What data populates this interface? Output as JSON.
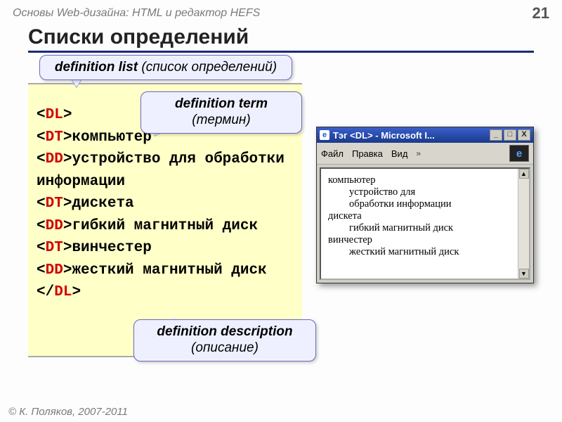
{
  "header": {
    "breadcrumb": "Основы Web-дизайна: HTML и редактор HEFS",
    "page_number": "21"
  },
  "title": "Списки определений",
  "callouts": {
    "dl_label": "definition list",
    "dl_paren": "(список определений)",
    "dt_label": "definition term",
    "dt_paren": "(термин)",
    "dd_label": "definition description",
    "dd_paren": "(описание)"
  },
  "code": {
    "open_tag_lt": "<",
    "open_tag_gt": ">",
    "slash": "/",
    "DL": "DL",
    "DT": "DT",
    "DD": "DD",
    "line_dt1": "компьютер",
    "line_dd1": "устройство для обработки информации",
    "line_dt2": "дискета",
    "line_dd2": "гибкий магнитный диск",
    "line_dt3": "винчестер",
    "line_dd3": "жесткий магнитный диск"
  },
  "browser": {
    "title": "Тэг <DL> - Microsoft I...",
    "menu": {
      "file": "Файл",
      "edit": "Правка",
      "view": "Вид"
    },
    "winbtn_min": "_",
    "winbtn_max": "□",
    "winbtn_close": "X",
    "scroll_up": "▲",
    "scroll_down": "▼",
    "chevrons": "»",
    "ie_glyph": "e",
    "dl": {
      "t1": "компьютер",
      "d1a": "устройство для",
      "d1b": "обработки информации",
      "t2": "дискета",
      "d2": "гибкий магнитный диск",
      "t3": "винчестер",
      "d3": "жесткий магнитный диск"
    }
  },
  "footer": "© К. Поляков, 2007-2011"
}
